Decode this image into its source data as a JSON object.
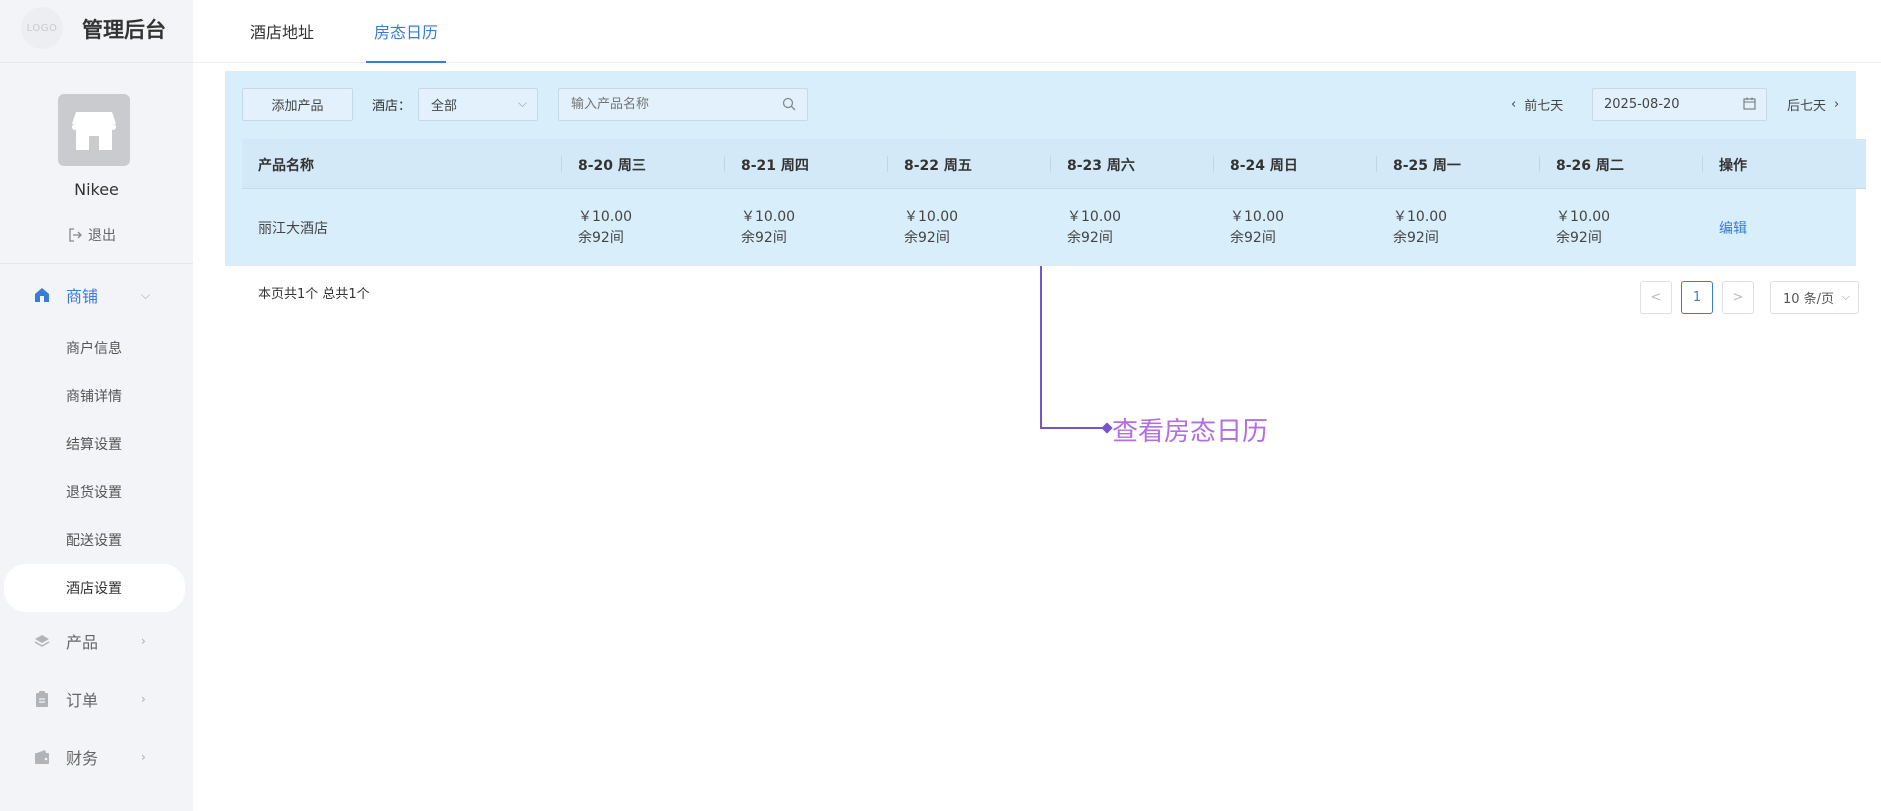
{
  "brand": {
    "logo_text": "LOGO",
    "title": "管理后台"
  },
  "profile": {
    "name": "Nikee",
    "logout": "退出"
  },
  "nav": {
    "groups": [
      {
        "label": "商铺",
        "icon": "home-icon",
        "expanded": true,
        "items": [
          "商户信息",
          "商铺详情",
          "结算设置",
          "退货设置",
          "配送设置",
          "酒店设置"
        ],
        "active_item": "酒店设置"
      },
      {
        "label": "产品",
        "icon": "layers-icon"
      },
      {
        "label": "订单",
        "icon": "clipboard-icon"
      },
      {
        "label": "财务",
        "icon": "wallet-icon"
      }
    ]
  },
  "tabs": [
    {
      "label": "酒店地址"
    },
    {
      "label": "房态日历",
      "active": true
    }
  ],
  "toolbar": {
    "add_button": "添加产品",
    "hotel_label": "酒店：",
    "hotel_select": "全部",
    "search_placeholder": "输入产品名称",
    "prev_week": "前七天",
    "date": "2025-08-20",
    "next_week": "后七天"
  },
  "table": {
    "headers": [
      "产品名称",
      "8-20 周三",
      "8-21 周四",
      "8-22 周五",
      "8-23 周六",
      "8-24 周日",
      "8-25 周一",
      "8-26 周二",
      "操作"
    ],
    "rows": [
      {
        "name": "丽江大酒店",
        "days": [
          {
            "price": "￥10.00",
            "remain": "余92间"
          },
          {
            "price": "￥10.00",
            "remain": "余92间"
          },
          {
            "price": "￥10.00",
            "remain": "余92间"
          },
          {
            "price": "￥10.00",
            "remain": "余92间"
          },
          {
            "price": "￥10.00",
            "remain": "余92间"
          },
          {
            "price": "￥10.00",
            "remain": "余92间"
          },
          {
            "price": "￥10.00",
            "remain": "余92间"
          }
        ],
        "action": "编辑"
      }
    ]
  },
  "pagination": {
    "summary": "本页共1个 总共1个",
    "prev": "<",
    "current": "1",
    "next": ">",
    "page_size": "10 条/页"
  },
  "annotation": {
    "text": "查看房态日历",
    "color": "#b36fe0"
  },
  "colors": {
    "accent": "#3a7bd5",
    "highlight": "#d9eefb",
    "annotation_line": "#7a55c8"
  }
}
